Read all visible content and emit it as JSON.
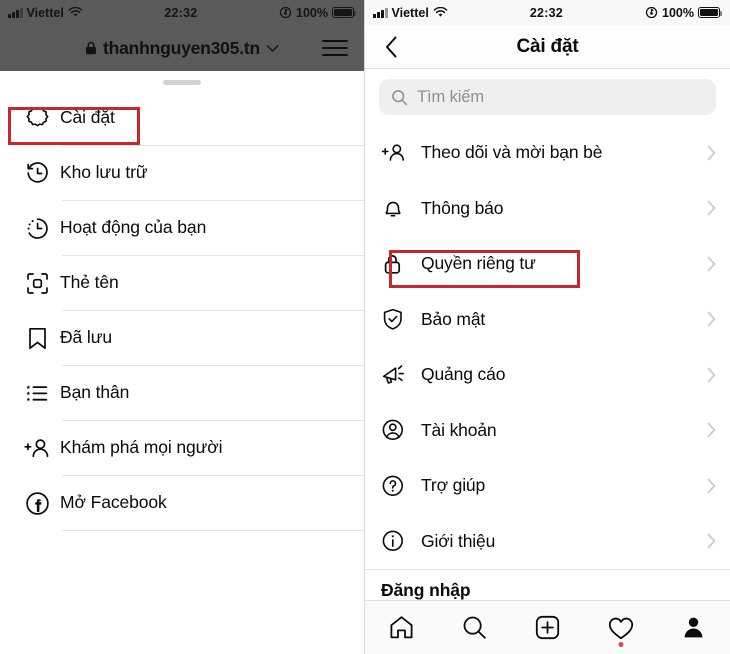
{
  "status_bar": {
    "carrier": "Viettel",
    "time": "22:32",
    "battery_percent": "100%",
    "signal_icon": "signal-bars-icon",
    "wifi_icon": "wifi-icon",
    "rotation_lock_icon": "rotation-lock-icon",
    "battery_icon": "battery-full-icon"
  },
  "browser": {
    "url": "thanhnguyen305.tn",
    "lock_icon": "lock-icon",
    "dropdown_icon": "chevron-down-icon",
    "menu_icon": "hamburger-menu-icon"
  },
  "left_panel": {
    "grabber": "drag-handle",
    "items": [
      {
        "label": "Cài đặt",
        "icon": "settings-gear-icon",
        "highlighted": true
      },
      {
        "label": "Kho lưu trữ",
        "icon": "archive-clock-icon",
        "highlighted": false
      },
      {
        "label": "Hoạt động của bạn",
        "icon": "activity-clock-icon",
        "highlighted": false
      },
      {
        "label": "Thẻ tên",
        "icon": "nametag-icon",
        "highlighted": false
      },
      {
        "label": "Đã lưu",
        "icon": "bookmark-icon",
        "highlighted": false
      },
      {
        "label": "Bạn thân",
        "icon": "close-friends-icon",
        "highlighted": false
      },
      {
        "label": "Khám phá mọi người",
        "icon": "discover-people-icon",
        "highlighted": false
      },
      {
        "label": "Mở Facebook",
        "icon": "facebook-icon",
        "highlighted": false
      }
    ]
  },
  "right_panel": {
    "title": "Cài đặt",
    "back_icon": "chevron-left-icon",
    "search": {
      "placeholder": "Tìm kiếm",
      "value": "",
      "icon": "search-icon"
    },
    "items": [
      {
        "label": "Theo dõi và mời bạn bè",
        "icon": "add-person-icon",
        "chevron": "chevron-right-icon",
        "highlighted": false
      },
      {
        "label": "Thông báo",
        "icon": "bell-icon",
        "chevron": "chevron-right-icon",
        "highlighted": false
      },
      {
        "label": "Quyền riêng tư",
        "icon": "lock-icon",
        "chevron": "chevron-right-icon",
        "highlighted": true
      },
      {
        "label": "Bảo mật",
        "icon": "shield-check-icon",
        "chevron": "chevron-right-icon",
        "highlighted": false
      },
      {
        "label": "Quảng cáo",
        "icon": "megaphone-icon",
        "chevron": "chevron-right-icon",
        "highlighted": false
      },
      {
        "label": "Tài khoản",
        "icon": "account-icon",
        "chevron": "chevron-right-icon",
        "highlighted": false
      },
      {
        "label": "Trợ giúp",
        "icon": "help-circle-icon",
        "chevron": "chevron-right-icon",
        "highlighted": false
      },
      {
        "label": "Giới thiệu",
        "icon": "info-circle-icon",
        "chevron": "chevron-right-icon",
        "highlighted": false
      }
    ],
    "section_label": "Đăng nhập"
  },
  "tabbar": {
    "items": [
      {
        "name": "home-icon",
        "badge": false
      },
      {
        "name": "search-icon",
        "badge": false
      },
      {
        "name": "add-post-icon",
        "badge": false
      },
      {
        "name": "heart-icon",
        "badge": true
      },
      {
        "name": "profile-icon",
        "badge": false
      }
    ]
  },
  "colors": {
    "highlight": "#c7262b",
    "badge": "#d9484f",
    "text": "#0b0b0b",
    "muted": "#8e8e93"
  }
}
